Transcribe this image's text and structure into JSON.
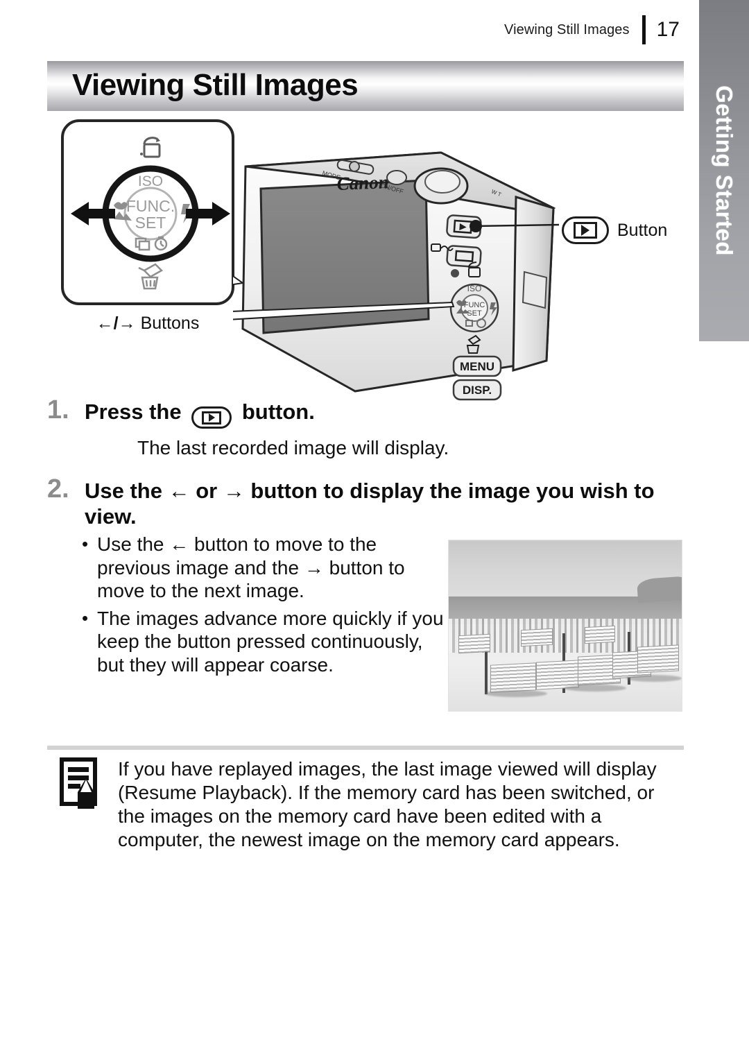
{
  "header": {
    "title": "Viewing Still Images",
    "page_number": "17"
  },
  "side_tab": {
    "label": "Getting Started"
  },
  "title_banner": {
    "text": "Viewing Still Images"
  },
  "dial_diagram": {
    "center_label_line1": "FUNC.",
    "center_label_line2": "SET",
    "top_label": "ISO",
    "print_share_icon": "print-share-icon",
    "macro_landscape_icon": "macro-landscape-icon",
    "flash_icon": "flash-icon",
    "drive_timer_icon": "drive-self-timer-icon",
    "trash_icon": "trash-icon",
    "caption": "Buttons",
    "caption_left_arrow": "←",
    "caption_right_arrow": "→"
  },
  "camera": {
    "brand": "Canon",
    "menu_button": "MENU",
    "disp_button": "DISP.",
    "playback_icon": "playback-icon",
    "print_share_icon": "print-share-icon",
    "power_label": "ON/OFF",
    "dial_center_line1": "FUNC",
    "dial_center_line2": "SET",
    "dial_iso": "ISO"
  },
  "callout": {
    "label": "Button",
    "icon": "playback-button-icon"
  },
  "steps": [
    {
      "number": "1.",
      "text_before": "Press the",
      "inline_icon": "playback-button-icon",
      "text_after": "button.",
      "subtext": "The last recorded image will display."
    },
    {
      "number": "2.",
      "text": "Use the ← or → button to display the image you wish to view."
    }
  ],
  "bullets": [
    "Use the ← button to move to the previous image and the → button to move to the next image.",
    "The images advance more quickly if you keep the button pressed continuously, but they will appear coarse."
  ],
  "photo": {
    "alt": "beach-with-lounge-chairs-photo"
  },
  "note": {
    "icon": "memo-note-icon",
    "text": "If you have replayed images, the last image viewed will display (Resume Playback). If the memory card has been switched, or the images on the memory card have been edited with a computer, the newest image on the memory card appears."
  },
  "colors": {
    "tab_gray": "#96989d",
    "step_number_gray": "#8c8c8c",
    "text_black": "#111111",
    "divider_gray": "#d2d2d2"
  }
}
